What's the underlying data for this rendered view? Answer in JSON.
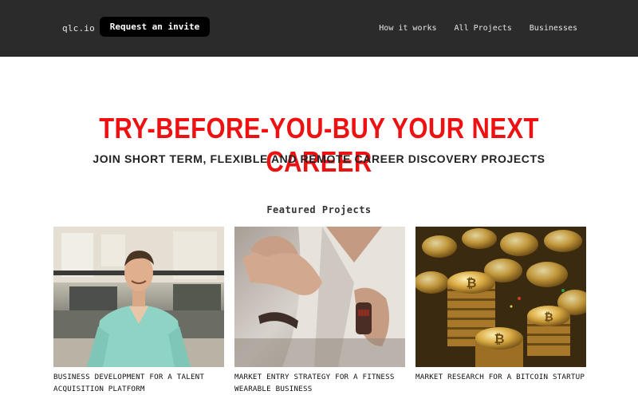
{
  "nav": {
    "logo": "qlc.io",
    "invite_button": "Request an invite",
    "links": [
      "How it works",
      "All Projects",
      "Businesses"
    ]
  },
  "hero": {
    "title": "TRY-BEFORE-YOU-BUY YOUR NEXT CAREER",
    "subtitle": "JOIN SHORT TERM, FLEXIBLE AND REMOTE CAREER DISCOVERY PROJECTS"
  },
  "featured": {
    "heading": "Featured Projects",
    "projects": [
      {
        "title": "BUSINESS DEVELOPMENT FOR A TALENT ACQUISITION PLATFORM",
        "image": "man-in-office-photo"
      },
      {
        "title": "MARKET ENTRY STRATEGY FOR A FITNESS WEARABLE BUSINESS",
        "image": "hands-with-wristband-photo"
      },
      {
        "title": "MARKET RESEARCH FOR A BITCOIN STARTUP",
        "image": "bitcoin-coins-photo"
      }
    ]
  },
  "colors": {
    "navbar_bg": "#2b2b2b",
    "accent_red": "#ee1111",
    "button_bg": "#000000"
  }
}
